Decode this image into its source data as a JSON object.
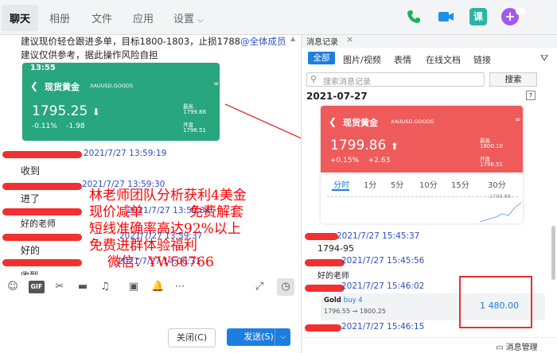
{
  "nav": {
    "tabs": [
      "聊天",
      "相册",
      "文件",
      "应用",
      "设置"
    ]
  },
  "icons": {
    "video_call": "video-call-icon",
    "phone": "phone-icon",
    "app_badge": "课",
    "plus": "+"
  },
  "chat": {
    "msg_line1": "建议现价轻仓跟进多单，目标1800-1803，止损1788",
    "mention": "@全体成员",
    "msg_line2": "建议仅供参考，据此操作风险自担",
    "card": {
      "time": "13:55",
      "title": "现货黄金",
      "code": "XAUUSD.GOODS",
      "price": "1795.25",
      "change_pct": "-0.11%",
      "change": "-1.98",
      "high_label": "最高",
      "high": "1799.88",
      "open_label": "开盘",
      "open": "1796.51"
    },
    "times": [
      "2021/7/27 13:59:19",
      "2021/7/27 13:59:30",
      "2021/7/27 13:59:34",
      "2021/7/27 13:59:37",
      "2021/7/27 14:00:31"
    ],
    "replies": [
      "收到",
      "进了",
      "好的老师",
      "好的",
      "收到"
    ],
    "overlay": [
      "林老师团队分析获利4美金",
      "现价减单",
      "免费解套",
      "短线准确率高达92%以上",
      "免费进群体验福利",
      "微信：YW56766"
    ]
  },
  "buttons": {
    "close": "关闭(C)",
    "send": "发送(S)"
  },
  "history": {
    "title": "消息记录",
    "filters": [
      "全部",
      "图片/视频",
      "表情",
      "在线文档",
      "链接"
    ],
    "search_placeholder": "搜索消息记录",
    "search_btn": "搜索",
    "date": "2021-07-27",
    "card": {
      "title": "现货黄金",
      "code": "XAUUSD.GOODS",
      "price": "1799.86",
      "change_pct": "+0.15%",
      "change": "+2.63",
      "high_label": "最高",
      "high": "1800.10",
      "open_label": "开盘",
      "open": "1796.51",
      "tabs": [
        "分时",
        "1分",
        "5分",
        "10分",
        "15分",
        "30分"
      ],
      "chart_label": "1799.88"
    },
    "times": [
      "2021/7/27 15:45:37",
      "2021/7/27 15:45:56",
      "2021/7/27 15:46:02",
      "2021/7/27 15:46:15"
    ],
    "msgs": [
      "1794-95",
      "好的老师"
    ],
    "trade": {
      "symbol": "Gold",
      "side": "buy 4",
      "from_to": "1796.55 → 1800.25",
      "profit": "1 480.00"
    },
    "manage": "消息管理"
  }
}
